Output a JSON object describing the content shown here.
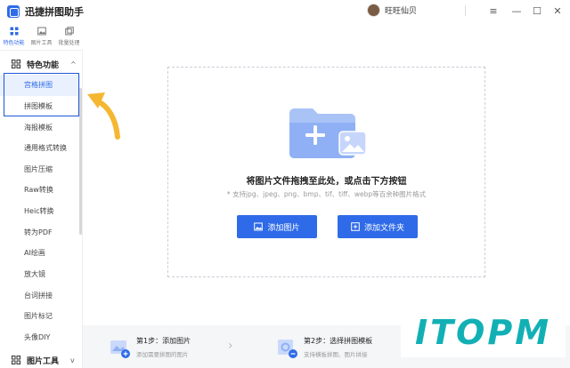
{
  "app": {
    "title": "迅捷拼图助手",
    "brand_color": "#2f6be8"
  },
  "user": {
    "name": "旺旺仙贝"
  },
  "window_controls": {
    "menu": "≡",
    "minimize": "—",
    "maximize": "☐",
    "close": "✕"
  },
  "top_tabs": [
    {
      "label": "特色功能",
      "icon": "grid-icon",
      "active": true
    },
    {
      "label": "图片工具",
      "icon": "image-icon",
      "active": false
    },
    {
      "label": "批量处理",
      "icon": "stack-icon",
      "active": false
    }
  ],
  "sidebar": {
    "section1": {
      "label": "特色功能",
      "chevron": "^"
    },
    "items": [
      {
        "label": "宫格拼图",
        "active": true
      },
      {
        "label": "拼图模板",
        "active": false
      },
      {
        "label": "海报模板",
        "active": false
      },
      {
        "label": "通用格式转换",
        "active": false
      },
      {
        "label": "图片压缩",
        "active": false
      },
      {
        "label": "Raw转换",
        "active": false
      },
      {
        "label": "Heic转换",
        "active": false
      },
      {
        "label": "转为PDF",
        "active": false
      },
      {
        "label": "AI绘画",
        "active": false
      },
      {
        "label": "放大镜",
        "active": false
      },
      {
        "label": "台词拼接",
        "active": false
      },
      {
        "label": "图片标记",
        "active": false
      },
      {
        "label": "头像DIY",
        "active": false
      }
    ],
    "section2": {
      "label": "图片工具",
      "chevron": "v"
    }
  },
  "dropzone": {
    "main_text": "将图片文件拖拽至此处，或点击下方按钮",
    "hint": "* 支持jpg、jpeg、png、bmp、tif、tiff、webp等百余种图片格式",
    "add_image_label": "添加图片",
    "add_folder_label": "添加文件夹"
  },
  "steps": [
    {
      "title": "第1步：添加图片",
      "subtitle": "添加需要拼图的图片"
    },
    {
      "title": "第2步：选择拼图模板",
      "subtitle": "支持横板拼图、图片拼接"
    }
  ],
  "watermark": {
    "text": "ITOPM",
    "color": "#12b0b5"
  },
  "annotation": {
    "arrow_color": "#f5b731",
    "box_color": "#1d57d8"
  }
}
